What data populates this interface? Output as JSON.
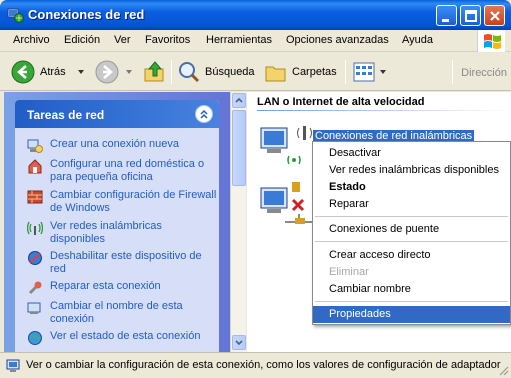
{
  "window": {
    "title": "Conexiones de red"
  },
  "menu": {
    "items": [
      "Archivo",
      "Edición",
      "Ver",
      "Favoritos",
      "Herramientas",
      "Opciones avanzadas",
      "Ayuda"
    ]
  },
  "toolbar": {
    "back": "Atrás",
    "search": "Búsqueda",
    "folders": "Carpetas",
    "address": "Dirección"
  },
  "left_panel": {
    "title": "Tareas de red",
    "tasks": [
      "Crear una conexión nueva",
      "Configurar una red doméstica o para pequeña oficina",
      "Cambiar configuración de Firewall de Windows",
      "Ver redes inalámbricas disponibles",
      "Deshabilitar este dispositivo de red",
      "Reparar esta conexión",
      "Cambiar el nombre de esta conexión",
      "Ver el estado de esta conexión"
    ]
  },
  "content": {
    "group_title": "LAN o Internet de alta velocidad",
    "selected_connection": "Conexiones de red inalámbricas"
  },
  "context_menu": {
    "items": [
      {
        "label": "Desactivar",
        "state": "normal"
      },
      {
        "label": "Ver redes inalámbricas disponibles",
        "state": "normal"
      },
      {
        "label": "Estado",
        "state": "default"
      },
      {
        "label": "Reparar",
        "state": "normal"
      },
      {
        "label": "Conexiones de puente",
        "state": "normal"
      },
      {
        "label": "Crear acceso directo",
        "state": "normal"
      },
      {
        "label": "Eliminar",
        "state": "disabled"
      },
      {
        "label": "Cambiar nombre",
        "state": "normal"
      },
      {
        "label": "Propiedades",
        "state": "selected"
      }
    ]
  },
  "status_bar": {
    "text": "Ver o cambiar la configuración de esta conexión, como los valores de configuración de adaptador"
  },
  "colors": {
    "title_bar": "#0b5ee0",
    "task_link": "#215dc6",
    "selection": "#316ac5",
    "panel_bg": "#d6dff7"
  }
}
